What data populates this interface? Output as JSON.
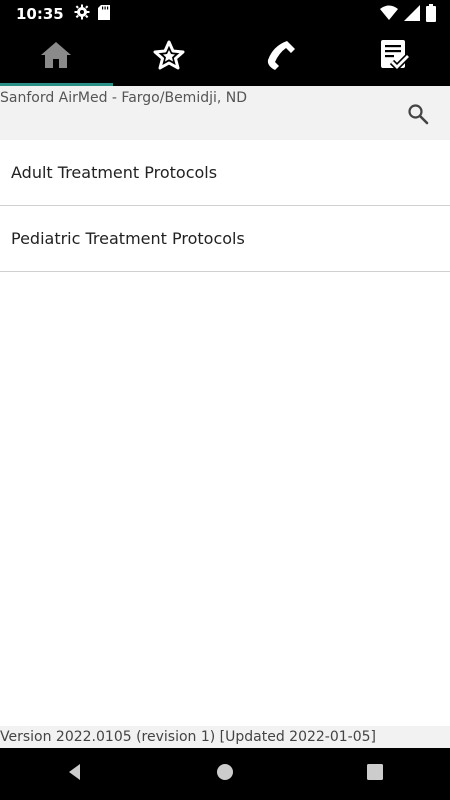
{
  "status_bar": {
    "time": "10:35",
    "icons": [
      "settings-gear-icon",
      "sd-card-icon",
      "wifi-icon",
      "signal-icon",
      "battery-icon"
    ]
  },
  "nav_tabs": [
    {
      "name": "home",
      "icon": "home-icon",
      "active": true
    },
    {
      "name": "favorites",
      "icon": "star-icon",
      "active": false
    },
    {
      "name": "phone",
      "icon": "phone-icon",
      "active": false
    },
    {
      "name": "checklist",
      "icon": "checklist-icon",
      "active": false
    }
  ],
  "header": {
    "title": "Sanford AirMed - Fargo/Bemidji, ND"
  },
  "list": {
    "items": [
      {
        "label": "Adult Treatment Protocols"
      },
      {
        "label": "Pediatric Treatment Protocols"
      }
    ]
  },
  "footer": {
    "version": "Version 2022.0105 (revision 1) [Updated 2022-01-05]"
  },
  "colors": {
    "accent": "#2a8f86",
    "bars": "#000000"
  }
}
